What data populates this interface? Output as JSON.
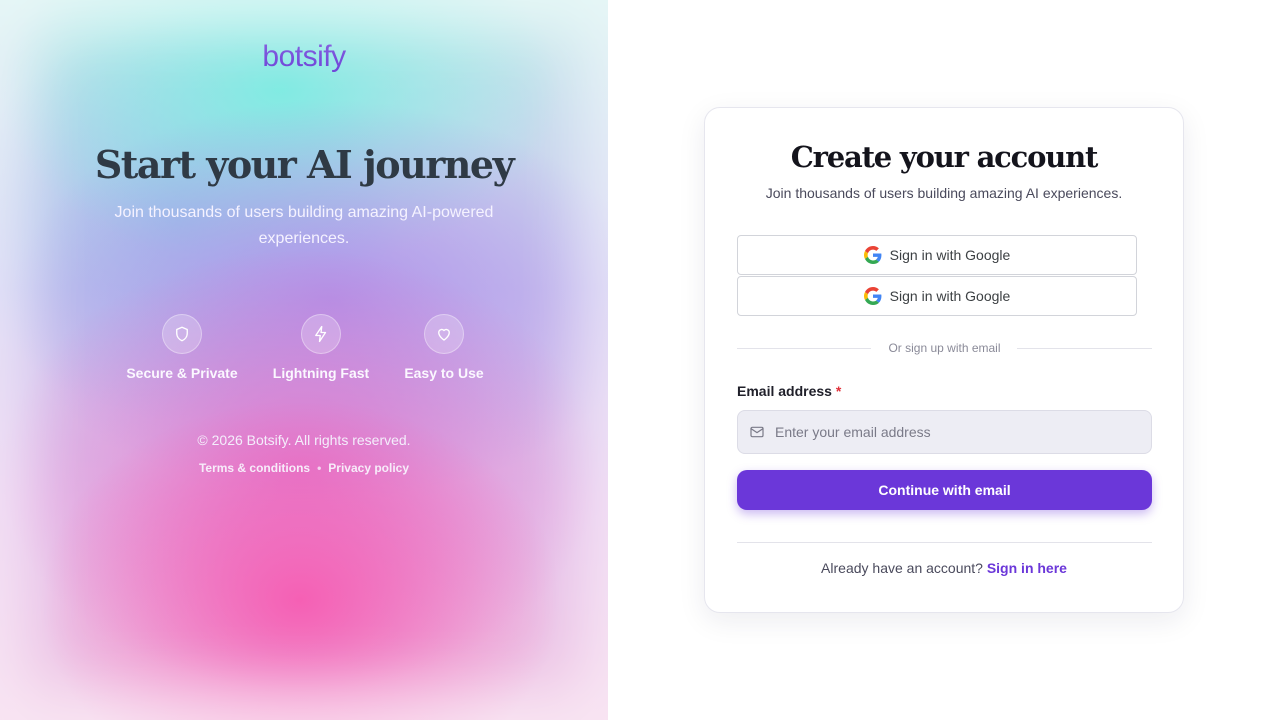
{
  "hero": {
    "logo": "botsify",
    "title": "Start your AI journey",
    "subtitle": "Join thousands of users building amazing AI-powered experiences.",
    "features": [
      {
        "label": "Secure & Private",
        "icon": "shield-icon"
      },
      {
        "label": "Lightning Fast",
        "icon": "lightning-icon"
      },
      {
        "label": "Easy to Use",
        "icon": "heart-icon"
      }
    ],
    "copyright": "© 2026 Botsify. All rights reserved.",
    "terms": "Terms & conditions",
    "separator": "•",
    "privacy": "Privacy policy"
  },
  "card": {
    "title": "Create your account",
    "subtitle": "Join thousands of users building amazing AI experiences.",
    "google_buttons": [
      "Sign in with Google",
      "Sign in with Google"
    ],
    "divider": "Or sign up with email",
    "email_label": "Email address",
    "required_mark": "*",
    "email_placeholder": "Enter your email address",
    "email_value": "",
    "continue_label": "Continue with email",
    "signin_prompt": "Already have an account?",
    "signin_link": "Sign in here"
  },
  "colors": {
    "accent": "#6b37d9",
    "required": "#e0313a"
  }
}
